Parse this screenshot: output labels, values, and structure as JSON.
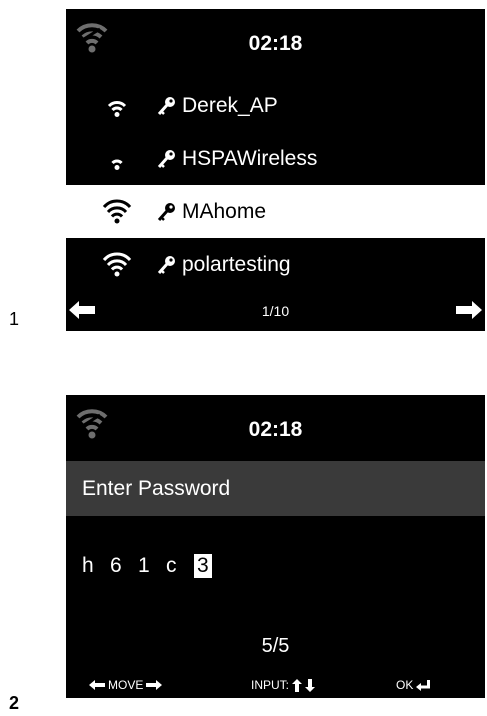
{
  "steps": {
    "one": "1",
    "two": "2"
  },
  "screen1": {
    "clock": "02:18",
    "networks": [
      {
        "ssid": "Derek_AP",
        "signal_bars": 3,
        "secured": true,
        "selected": false
      },
      {
        "ssid": "HSPAWireless",
        "signal_bars": 2,
        "secured": true,
        "selected": false
      },
      {
        "ssid": "MAhome",
        "signal_bars": 4,
        "secured": true,
        "selected": true
      },
      {
        "ssid": "polartesting",
        "signal_bars": 4,
        "secured": true,
        "selected": false
      }
    ],
    "pager": "1/10",
    "icons": {
      "status": "wifi-icon",
      "lock": "key-icon",
      "prev": "arrow-left-icon",
      "next": "arrow-right-icon"
    }
  },
  "screen2": {
    "clock": "02:18",
    "title": "Enter Password",
    "password_chars": [
      "h",
      "6",
      "1",
      "c"
    ],
    "cursor_char": "3",
    "position": "5/5",
    "footer": {
      "move_label": "MOVE",
      "input_label": "INPUT:",
      "ok_label": "OK"
    },
    "icons": {
      "status": "wifi-icon",
      "move_left": "arrow-left-icon",
      "move_right": "arrow-right-icon",
      "input_up": "arrow-up-icon",
      "input_down": "arrow-down-icon",
      "ok": "enter-icon"
    }
  },
  "colors": {
    "screen_bg": "#000000",
    "text": "#ffffff",
    "selected_bg": "#ffffff",
    "header_bar_bg": "#3a3a3a",
    "status_wifi": "#6e6e6e"
  }
}
